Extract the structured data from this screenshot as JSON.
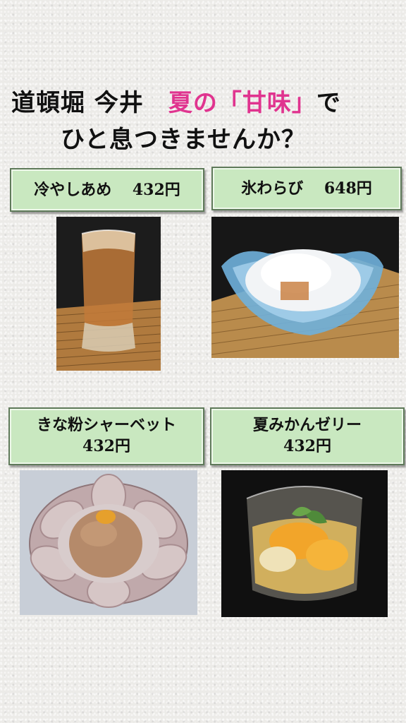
{
  "headline": {
    "line1_prefix": "道頓堀 今井　",
    "line1_highlight": "夏の「甘味」",
    "line1_suffix": "で",
    "line2": "ひと息つきませんか？"
  },
  "items": [
    {
      "name": "冷やしあめ",
      "price": "432円"
    },
    {
      "name": "氷わらび",
      "price": "648円"
    },
    {
      "name": "きな粉シャーベット",
      "price": "432円"
    },
    {
      "name": "夏みかんゼリー",
      "price": "432円"
    }
  ],
  "colors": {
    "highlight": "#e0348f",
    "label_bg": "#c9e8c0"
  }
}
